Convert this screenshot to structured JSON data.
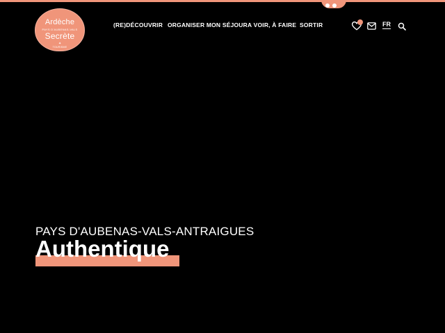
{
  "logo": {
    "line1": "Ardèche",
    "sub": "PAYS D'AUBENAS-VALS",
    "line2": "Secrète",
    "star": "✦",
    "foot": "TOURISME"
  },
  "nav": {
    "items": [
      {
        "label": "(RE)DÉCOUVRIR"
      },
      {
        "label": "ORGANISER MON SÉJOUR"
      },
      {
        "label": "A VOIR, À FAIRE"
      },
      {
        "label": "SORTIR"
      }
    ]
  },
  "header": {
    "language": "FR",
    "icons": [
      "heart-icon",
      "mail-icon",
      "search-icon"
    ]
  },
  "hero": {
    "subtitle": "PAYS D'AUBENAS-VALS-ANTRAIGUES",
    "title": "Authentique"
  },
  "colors": {
    "accent": "#f0957a",
    "background": "#000000",
    "text": "#ffffff"
  }
}
